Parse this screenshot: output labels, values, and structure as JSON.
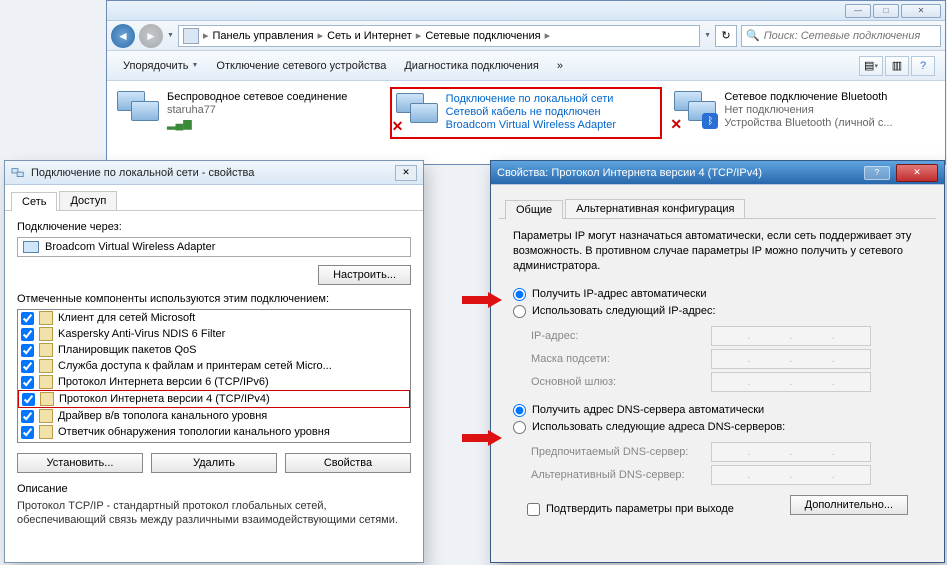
{
  "explorer": {
    "breadcrumb": [
      "Панель управления",
      "Сеть и Интернет",
      "Сетевые подключения"
    ],
    "search_placeholder": "Поиск: Сетевые подключения",
    "toolbar": {
      "organize": "Упорядочить",
      "disable": "Отключение сетевого устройства",
      "diagnose": "Диагностика подключения"
    },
    "connections": [
      {
        "title": "Беспроводное сетевое соединение",
        "line2": "staruha77",
        "line3": ""
      },
      {
        "title": "Подключение по локальной сети",
        "line2": "Сетевой кабель не подключен",
        "line3": "Broadcom Virtual Wireless Adapter"
      },
      {
        "title": "Сетевое подключение Bluetooth",
        "line2": "Нет подключения",
        "line3": "Устройства Bluetooth (личной с..."
      }
    ]
  },
  "dlg1": {
    "title": "Подключение по локальной сети - свойства",
    "tabs": [
      "Сеть",
      "Доступ"
    ],
    "conn_via_label": "Подключение через:",
    "adapter": "Broadcom Virtual Wireless Adapter",
    "configure_btn": "Настроить...",
    "components_label": "Отмеченные компоненты используются этим подключением:",
    "components": [
      "Клиент для сетей Microsoft",
      "Kaspersky Anti-Virus NDIS 6 Filter",
      "Планировщик пакетов QoS",
      "Служба доступа к файлам и принтерам сетей Micro...",
      "Протокол Интернета версии 6 (TCP/IPv6)",
      "Протокол Интернета версии 4 (TCP/IPv4)",
      "Драйвер в/в тополога канального уровня",
      "Ответчик обнаружения топологии канального уровня"
    ],
    "selected_index": 5,
    "install_btn": "Установить...",
    "remove_btn": "Удалить",
    "props_btn": "Свойства",
    "desc_label": "Описание",
    "desc_text": "Протокол TCP/IP - стандартный протокол глобальных сетей, обеспечивающий связь между различными взаимодействующими сетями."
  },
  "dlg2": {
    "title": "Свойства: Протокол Интернета версии 4 (TCP/IPv4)",
    "tabs": [
      "Общие",
      "Альтернативная конфигурация"
    ],
    "info": "Параметры IP могут назначаться автоматически, если сеть поддерживает эту возможность. В противном случае параметры IP можно получить у сетевого администратора.",
    "ip_auto": "Получить IP-адрес автоматически",
    "ip_manual": "Использовать следующий IP-адрес:",
    "ip_addr_label": "IP-адрес:",
    "mask_label": "Маска подсети:",
    "gateway_label": "Основной шлюз:",
    "dns_auto": "Получить адрес DNS-сервера автоматически",
    "dns_manual": "Использовать следующие адреса DNS-серверов:",
    "dns_pref_label": "Предпочитаемый DNS-сервер:",
    "dns_alt_label": "Альтернативный DNS-сервер:",
    "validate_chk": "Подтвердить параметры при выходе",
    "advanced_btn": "Дополнительно..."
  }
}
